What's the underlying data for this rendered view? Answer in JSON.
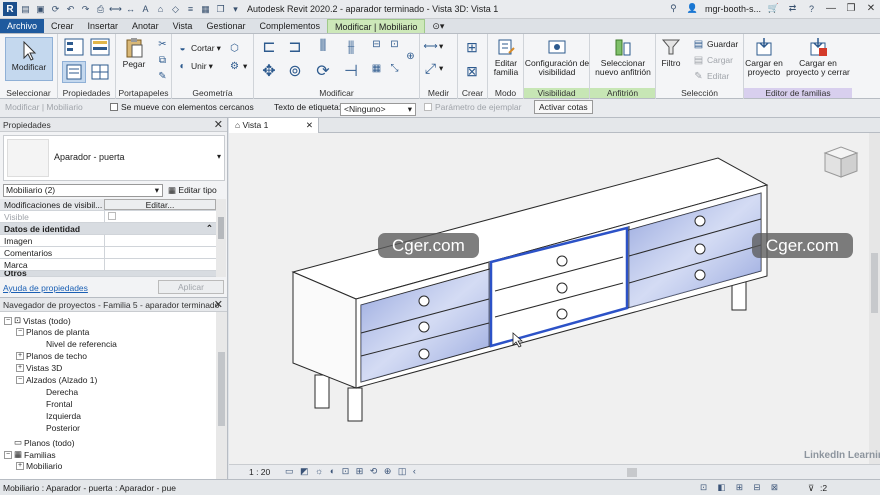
{
  "title_bar": {
    "app_title": "Autodesk Revit 2020.2 - aparador terminado - Vista 3D: Vista 1",
    "user": "mgr-booth-s..."
  },
  "tabs": [
    {
      "label": "Archivo"
    },
    {
      "label": "Crear"
    },
    {
      "label": "Insertar"
    },
    {
      "label": "Anotar"
    },
    {
      "label": "Vista"
    },
    {
      "label": "Gestionar"
    },
    {
      "label": "Complementos"
    },
    {
      "label": "Modificar | Mobiliario"
    }
  ],
  "ribbon": {
    "panels": {
      "seleccionar": "Seleccionar",
      "propiedades": "Propiedades",
      "portapapeles": "Portapapeles",
      "geometria": "Geometría",
      "modificar": "Modificar",
      "medir": "Medir",
      "crear": "Crear",
      "modo": "Modo",
      "visibilidad": "Visibilidad",
      "anfitrion": "Anfitrión",
      "seleccion": "Selección",
      "editor_familias": "Editor de familias"
    },
    "buttons": {
      "modificar": "Modificar",
      "pegar": "Pegar",
      "cortar": "Cortar",
      "unir": "Unir",
      "editar_familia_1": "Editar",
      "editar_familia_2": "familia",
      "config_vis_1": "Configuración de",
      "config_vis_2": "visibilidad",
      "nuevo_anf_1": "Seleccionar",
      "nuevo_anf_2": "nuevo anfitrión",
      "filtro": "Filtro",
      "guardar": "Guardar",
      "cargar": "Cargar",
      "editar": "Editar",
      "cargar_proy_1": "Cargar en",
      "cargar_proy_2": "proyecto",
      "cargar_cerrar_1": "Cargar en",
      "cargar_cerrar_2": "proyecto y cerrar"
    }
  },
  "options_bar": {
    "context": "Modificar | Mobiliario",
    "moves_label": "Se mueve con elementos cercanos",
    "tag_label": "Texto de etiqueta:",
    "tag_value": "<Ninguno>",
    "instance_param": "Parámetro de ejemplar",
    "activate_dims": "Activar cotas"
  },
  "properties": {
    "header": "Propiedades",
    "type_name": "Aparador - puerta",
    "category": "Mobiliario (2)",
    "edit_type": "Editar tipo",
    "rows": [
      {
        "key": "Modificaciones de visibil...",
        "value": "Editar..."
      },
      {
        "key": "Visible",
        "value": ""
      }
    ],
    "group": "Datos de identidad",
    "identity_rows": [
      {
        "key": "Imagen"
      },
      {
        "key": "Comentarios"
      },
      {
        "key": "Marca"
      },
      {
        "key": "Otros"
      }
    ],
    "help_link": "Ayuda de propiedades",
    "apply": "Aplicar"
  },
  "browser": {
    "header": "Navegador de proyectos - Familia 5 - aparador terminado",
    "items": [
      {
        "label": "Vistas (todo)"
      },
      {
        "label": "Planos de planta"
      },
      {
        "label": "Nivel de referencia"
      },
      {
        "label": "Planos de techo"
      },
      {
        "label": "Vistas 3D"
      },
      {
        "label": "Alzados (Alzado 1)"
      },
      {
        "label": "Derecha"
      },
      {
        "label": "Frontal"
      },
      {
        "label": "Izquierda"
      },
      {
        "label": "Posterior"
      },
      {
        "label": "Planos (todo)"
      },
      {
        "label": "Familias"
      },
      {
        "label": "Mobiliario"
      }
    ]
  },
  "view": {
    "tab": "Vista 1",
    "scale": "1 : 20",
    "watermark": "Cger.com"
  },
  "status": {
    "text": "Mobiliario : Aparador - puerta : Aparador - pue",
    "zoom_level": ":2",
    "brand": "LinkedIn Learning"
  }
}
